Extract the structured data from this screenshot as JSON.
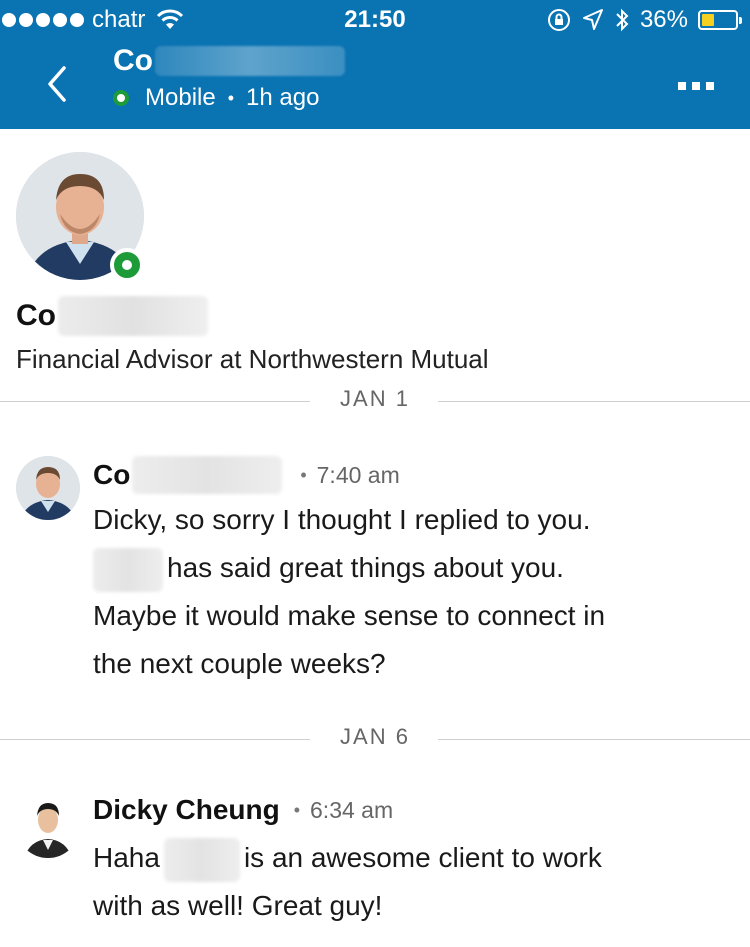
{
  "status_bar": {
    "carrier": "chatr",
    "time": "21:50",
    "battery_percent": "36%",
    "battery_level": 0.36,
    "battery_color": "#f5d020"
  },
  "header": {
    "background": "#0a73b2",
    "back_icon": "chevron-left-icon",
    "contact_name_visible": "Co",
    "status": "Mobile",
    "last_seen": "1h ago",
    "more_icon": "ellipsis-icon"
  },
  "profile": {
    "name_visible": "Co",
    "headline": "Financial Advisor at Northwestern Mutual",
    "presence_color": "#1d9b39"
  },
  "dividers": [
    {
      "label": "JAN 1"
    },
    {
      "label": "JAN 6"
    }
  ],
  "messages": [
    {
      "sender_visible": "Co",
      "time": "7:40 am",
      "line1": "Dicky, so sorry I thought I replied to you.",
      "line2_rest": "has said great things about you.",
      "line3": "Maybe it would make sense to connect in",
      "line4": "the next couple weeks?"
    },
    {
      "sender": "Dicky Cheung",
      "time": "6:34 am",
      "line1_start": "Haha",
      "line1_rest": "is an awesome client to work",
      "line2": "with as well! Great guy!"
    }
  ]
}
